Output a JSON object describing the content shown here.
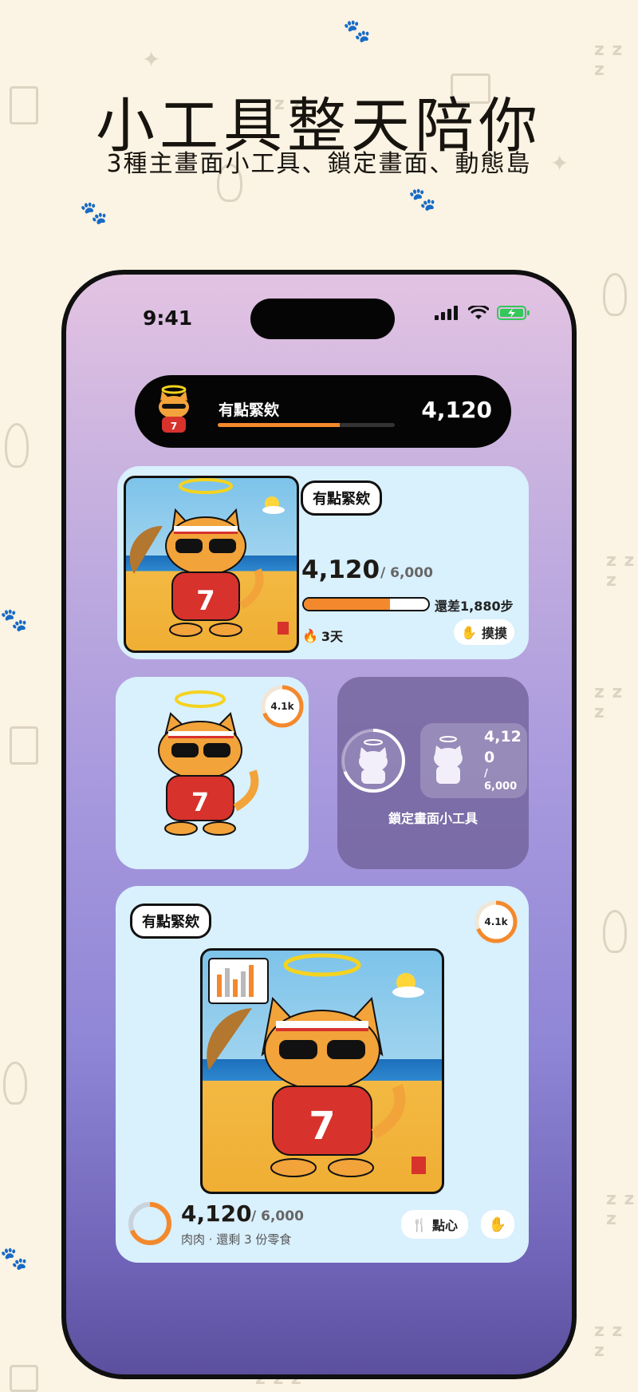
{
  "header": {
    "title": "小工具整天陪你",
    "subtitle": "3種主畫面小工具、鎖定畫面、動態島"
  },
  "status_bar": {
    "time": "9:41"
  },
  "dynamic_island_widget": {
    "name": "有點緊欸",
    "steps": "4,120",
    "progress": 0.69
  },
  "medium_widget": {
    "badge": "有點緊欸",
    "steps": "4,120",
    "goal": "/ 6,000",
    "remaining": "還差1,880步",
    "progress": 0.69,
    "streak": "3天",
    "pet_button": "摸摸"
  },
  "small_widget": {
    "ring_label": "4.1k",
    "progress": 0.69
  },
  "lock_widget": {
    "steps_line1": "4,12",
    "steps_line2": "0",
    "goal_line1": "/",
    "goal_line2": "6,000",
    "caption": "鎖定畫面小工具"
  },
  "large_widget": {
    "badge": "有點緊欸",
    "ring_label": "4.1k",
    "steps": "4,120",
    "goal": "/ 6,000",
    "food_line": "肉肉 · 還剩 3 份零食",
    "snack_button": "點心",
    "progress": 0.69
  },
  "colors": {
    "accent": "#f3892c",
    "card": "#d9f0fd",
    "battery": "#34c759"
  }
}
